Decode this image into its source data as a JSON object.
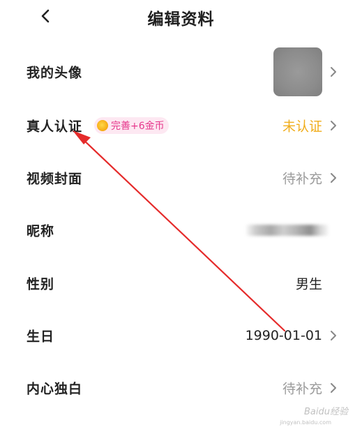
{
  "header": {
    "title": "编辑资料"
  },
  "rows": {
    "avatar": {
      "label": "我的头像"
    },
    "verify": {
      "label": "真人认证",
      "badge": "完善+6金币",
      "value": "未认证"
    },
    "cover": {
      "label": "视频封面",
      "value": "待补充"
    },
    "nickname": {
      "label": "昵称"
    },
    "gender": {
      "label": "性别",
      "value": "男生"
    },
    "birthday": {
      "label": "生日",
      "value": "1990-01-01"
    },
    "bio": {
      "label": "内心独白",
      "value": "待补充"
    }
  },
  "watermark": {
    "text": "Baidu经验",
    "sub": "jingyan.baidu.com"
  },
  "colors": {
    "accent_orange": "#f0ad1c",
    "badge_pink": "#e6388c",
    "annotation_red": "#e52b2b"
  }
}
